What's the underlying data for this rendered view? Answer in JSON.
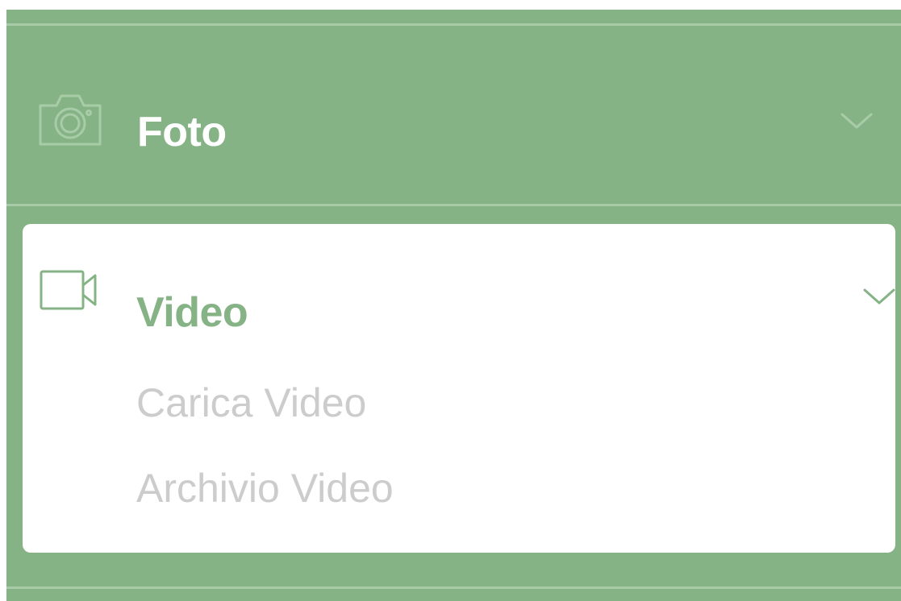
{
  "menu": {
    "sections": [
      {
        "label": "Foto",
        "icon": "camera-icon",
        "expanded": false,
        "chevron": "chevron-down-icon"
      },
      {
        "label": "Video",
        "icon": "video-camera-icon",
        "expanded": true,
        "chevron": "chevron-down-icon",
        "items": [
          {
            "label": "Carica Video"
          },
          {
            "label": "Archivio Video"
          }
        ]
      }
    ]
  },
  "colors": {
    "sidebar_background": "#85b385",
    "divider": "#a8cca8",
    "active_panel_background": "#ffffff",
    "active_label": "#85b385",
    "inactive_label": "#ffffff",
    "submenu_text": "#cccccc"
  }
}
